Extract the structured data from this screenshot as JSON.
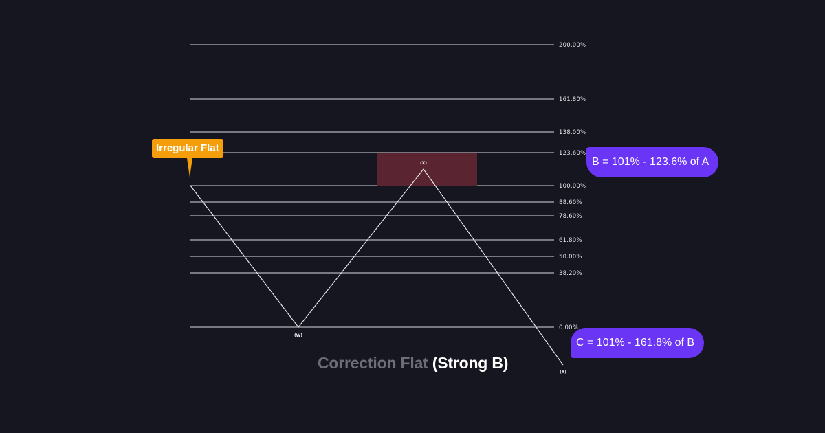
{
  "levels": [
    {
      "label": "200.00%",
      "value": 200.0
    },
    {
      "label": "161.80%",
      "value": 161.8
    },
    {
      "label": "138.00%",
      "value": 138.0
    },
    {
      "label": "123.60%",
      "value": 123.6
    },
    {
      "label": "100.00%",
      "value": 100.0
    },
    {
      "label": "88.60%",
      "value": 88.6
    },
    {
      "label": "78.60%",
      "value": 78.6
    },
    {
      "label": "61.80%",
      "value": 61.8
    },
    {
      "label": "50.00%",
      "value": 50.0
    },
    {
      "label": "38.20%",
      "value": 38.2
    },
    {
      "label": "0.00%",
      "value": 0.0
    }
  ],
  "waves": [
    {
      "label": "(W)"
    },
    {
      "label": "(X)"
    },
    {
      "label": "(Y)"
    }
  ],
  "callouts": {
    "pattern_tag": "Irregular Flat",
    "b_rule": "B = 101% - 123.6% of A",
    "c_rule": "C = 101% - 161.8% of B"
  },
  "title": {
    "main": "Correction Flat",
    "accent": "(Strong B)"
  },
  "colors": {
    "background": "#161621",
    "tag": "#f59e0b",
    "bubble": "#6b35f5",
    "zone": "#5a2531",
    "title_muted": "#6d6d78"
  }
}
